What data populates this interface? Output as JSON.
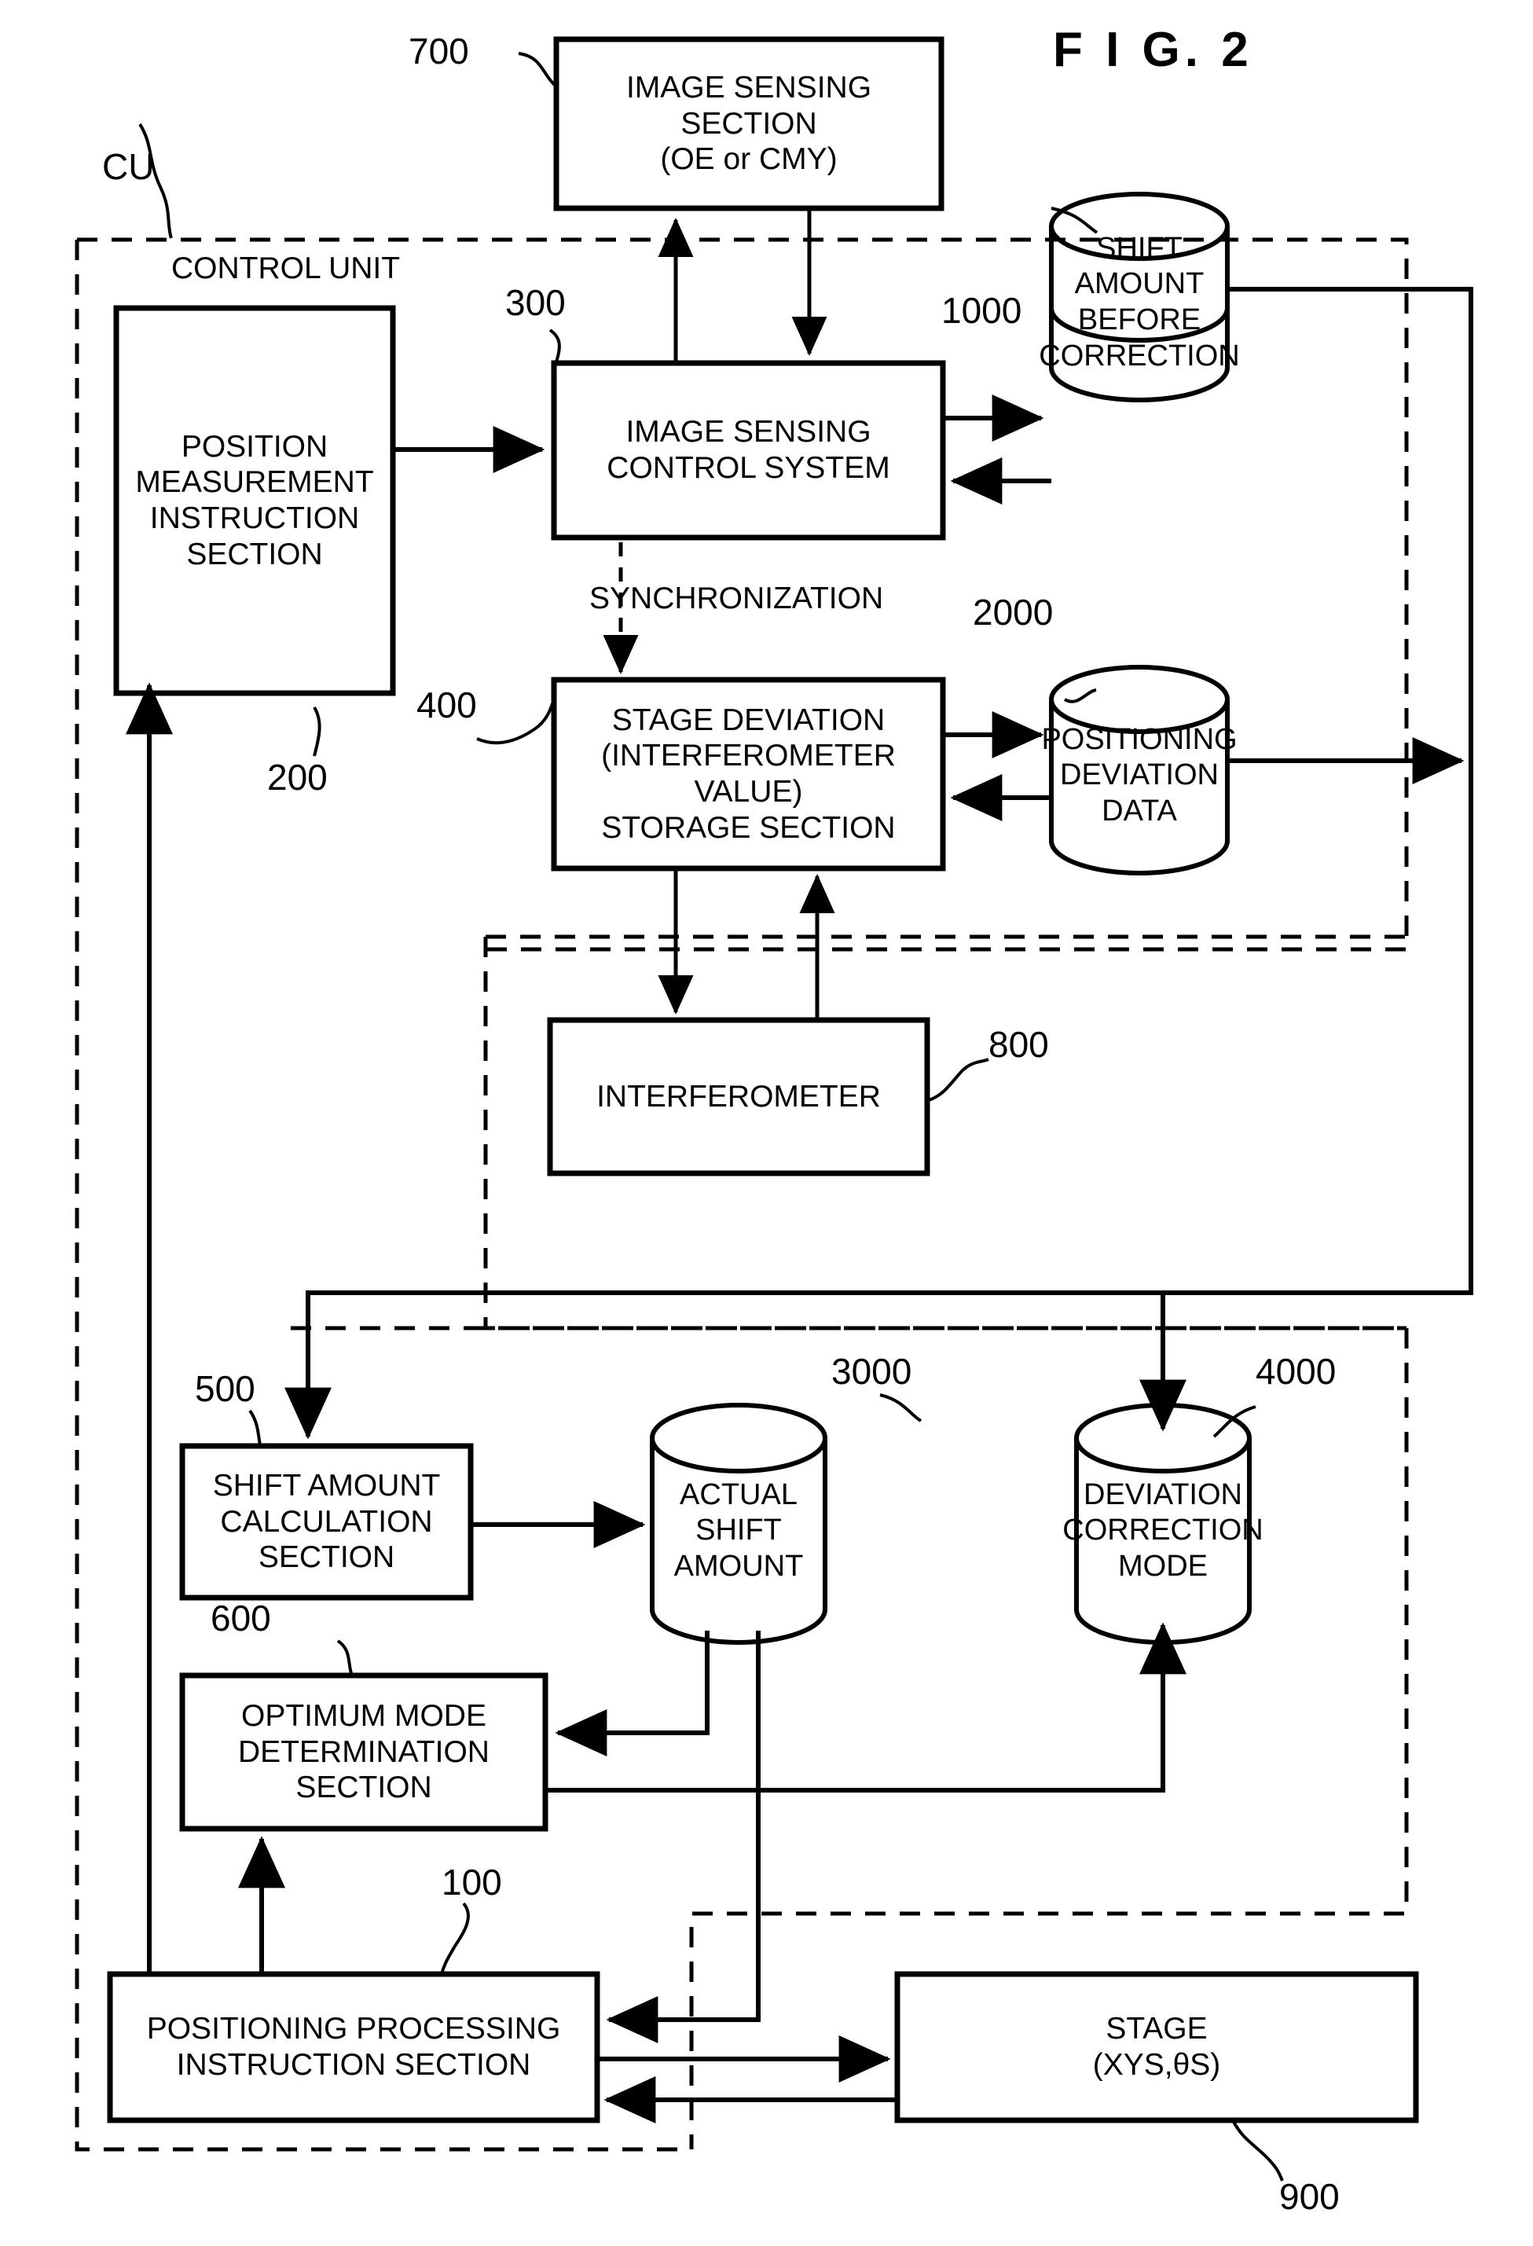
{
  "figure": {
    "title": "F I G.  2"
  },
  "annotations": {
    "cu_tag": "CU",
    "control_unit_label": "CONTROL UNIT",
    "synchronization_label": "SYNCHRONIZATION"
  },
  "blocks": [
    {
      "id": "image-sensing-section",
      "ref": "700",
      "label": "IMAGE SENSING\nSECTION\n(OE or CMY)"
    },
    {
      "id": "position-measurement-instruction-section",
      "ref": "200",
      "label": "POSITION\nMEASUREMENT\nINSTRUCTION\nSECTION"
    },
    {
      "id": "image-sensing-control-system",
      "ref": "300",
      "label": "IMAGE SENSING\nCONTROL SYSTEM"
    },
    {
      "id": "stage-deviation-storage-section",
      "ref": "400",
      "label": "STAGE DEVIATION\n(INTERFEROMETER\nVALUE)\nSTORAGE SECTION"
    },
    {
      "id": "interferometer",
      "ref": "800",
      "label": "INTERFEROMETER"
    },
    {
      "id": "shift-amount-calculation-section",
      "ref": "500",
      "label": "SHIFT AMOUNT\nCALCULATION\nSECTION"
    },
    {
      "id": "optimum-mode-determination-section",
      "ref": "600",
      "label": "OPTIMUM MODE\nDETERMINATION\nSECTION"
    },
    {
      "id": "positioning-processing-instruction-section",
      "ref": "100",
      "label": "POSITIONING PROCESSING\nINSTRUCTION SECTION"
    },
    {
      "id": "stage",
      "ref": "900",
      "label": "STAGE\n(XYS,θS)"
    }
  ],
  "datastores": [
    {
      "id": "shift-amount-before-correction",
      "ref": "1000",
      "label": "SHIFT AMOUNT\nBEFORE\nCORRECTION"
    },
    {
      "id": "positioning-deviation-data",
      "ref": "2000",
      "label": "POSITIONING\nDEVIATION\nDATA"
    },
    {
      "id": "actual-shift-amount",
      "ref": "3000",
      "label": "ACTUAL\nSHIFT\nAMOUNT"
    },
    {
      "id": "deviation-correction-mode",
      "ref": "4000",
      "label": "DEVIATION\nCORRECTION\nMODE"
    }
  ],
  "colors": {
    "stroke": "#000000",
    "background": "#ffffff"
  }
}
